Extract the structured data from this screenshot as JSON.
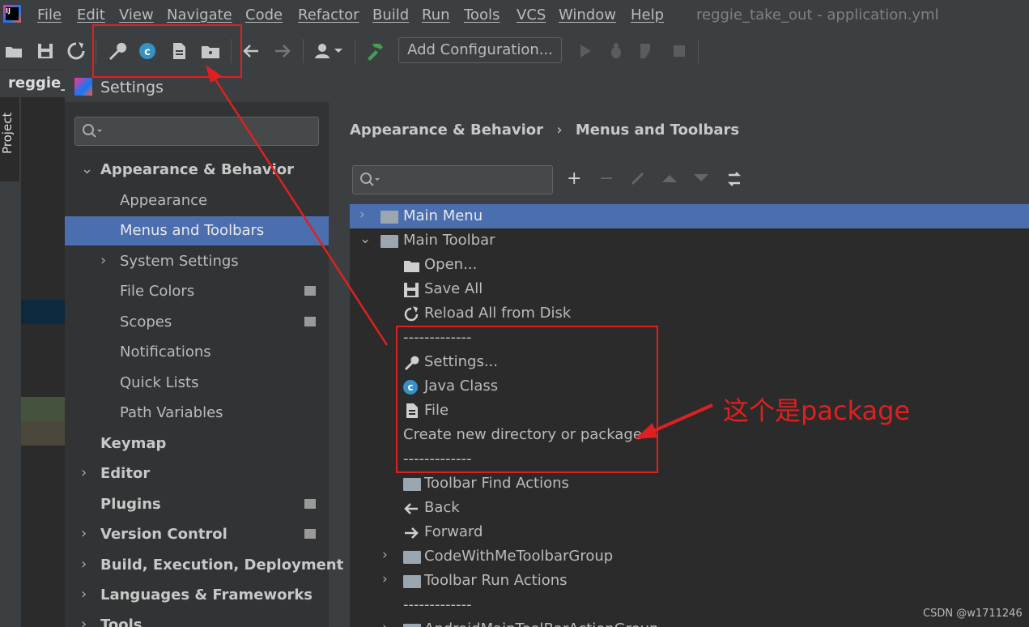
{
  "menubar": {
    "items": [
      "File",
      "Edit",
      "View",
      "Navigate",
      "Code",
      "Refactor",
      "Build",
      "Run",
      "Tools",
      "VCS",
      "Window",
      "Help"
    ],
    "window_title": "reggie_take_out - application.yml"
  },
  "toolbar": {
    "add_configuration": "Add Configuration..."
  },
  "ide": {
    "project_tab": "reggie_t",
    "project_strip_label": "Project"
  },
  "settings": {
    "title": "Settings",
    "tree": [
      {
        "label": "Appearance & Behavior",
        "bold": true,
        "expanded": true
      },
      {
        "label": "Appearance"
      },
      {
        "label": "Menus and Toolbars",
        "selected": true
      },
      {
        "label": "System Settings"
      },
      {
        "label": "File Colors"
      },
      {
        "label": "Scopes"
      },
      {
        "label": "Notifications"
      },
      {
        "label": "Quick Lists"
      },
      {
        "label": "Path Variables"
      },
      {
        "label": "Keymap",
        "bold": true
      },
      {
        "label": "Editor",
        "bold": true
      },
      {
        "label": "Plugins",
        "bold": true
      },
      {
        "label": "Version Control",
        "bold": true
      },
      {
        "label": "Build, Execution, Deployment",
        "bold": true
      },
      {
        "label": "Languages & Frameworks",
        "bold": true
      },
      {
        "label": "Tools",
        "bold": true
      }
    ],
    "breadcrumb": {
      "parent": "Appearance & Behavior",
      "sep": "›",
      "current": "Menus and Toolbars"
    },
    "actions_tree": [
      {
        "label": "Main Menu"
      },
      {
        "label": "Main Toolbar"
      },
      {
        "label": "Open..."
      },
      {
        "label": "Save All"
      },
      {
        "label": "Reload All from Disk"
      },
      {
        "label": "-------------"
      },
      {
        "label": "Settings..."
      },
      {
        "label": "Java Class"
      },
      {
        "label": "File"
      },
      {
        "label": "Create new directory or package"
      },
      {
        "label": "-------------"
      },
      {
        "label": "Toolbar Find Actions"
      },
      {
        "label": "Back"
      },
      {
        "label": "Forward"
      },
      {
        "label": "CodeWithMeToolbarGroup"
      },
      {
        "label": "Toolbar Run Actions"
      },
      {
        "label": "-------------"
      },
      {
        "label": "AndroidMainToolBarActionGroup"
      }
    ]
  },
  "annotation": {
    "text": "这个是package"
  },
  "watermark": "CSDN @w1711246",
  "colors": {
    "selection": "#4b6eaf",
    "annotation": "#e02020",
    "java_class": "#3592c4"
  }
}
